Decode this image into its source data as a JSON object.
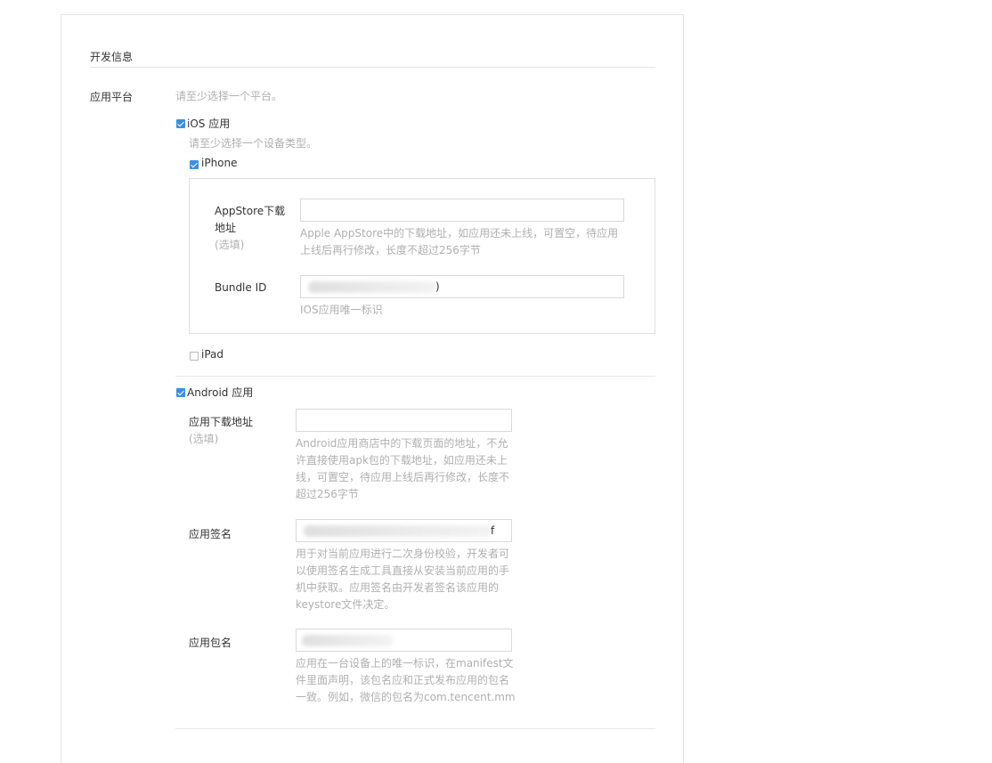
{
  "section": {
    "title": "开发信息"
  },
  "platform": {
    "label": "应用平台",
    "hint": "请至少选择一个平台。"
  },
  "ios": {
    "label": "iOS 应用",
    "checked": true,
    "device_hint": "请至少选择一个设备类型。",
    "iphone": {
      "label": "iPhone",
      "checked": true,
      "appstore": {
        "label_line1": "AppStore下载",
        "label_line2": "地址",
        "optional": "(选填)",
        "value": "",
        "hint_line1": "Apple AppStore中的下载地址，如应用还未上线，可置空，待应用",
        "hint_line2": "上线后再行修改，长度不超过256字节"
      },
      "bundle": {
        "label": "Bundle ID",
        "value_tail": ")",
        "hint": "IOS应用唯一标识"
      }
    },
    "ipad": {
      "label": "iPad",
      "checked": false
    }
  },
  "android": {
    "label": "Android 应用",
    "checked": true,
    "download": {
      "label": "应用下载地址",
      "optional": "(选填)",
      "value": "",
      "hint": [
        "Android应用商店中的下载页面的地址，不允",
        "许直接使用apk包的下载地址，如应用还未上",
        "线，可置空，待应用上线后再行修改，长度不",
        "超过256字节"
      ]
    },
    "signature": {
      "label": "应用签名",
      "value_tail": "f",
      "hint": [
        "用于对当前应用进行二次身份校验，开发者可",
        "以使用签名生成工具直接从安装当前应用的手",
        "机中获取。应用签名由开发者签名该应用的",
        "keystore文件决定。"
      ]
    },
    "package": {
      "label": "应用包名",
      "value_tail": "",
      "hint": [
        "应用在一台设备上的唯一标识，在manifest文",
        "件里面声明，该包名应和正式发布应用的包名",
        "一致。例如，微信的包名为com.tencent.mm"
      ]
    }
  },
  "colors": {
    "checkbox_accent": "#3b8ee6",
    "hint_text": "#b0b0b0",
    "border": "#e0e0e0"
  }
}
